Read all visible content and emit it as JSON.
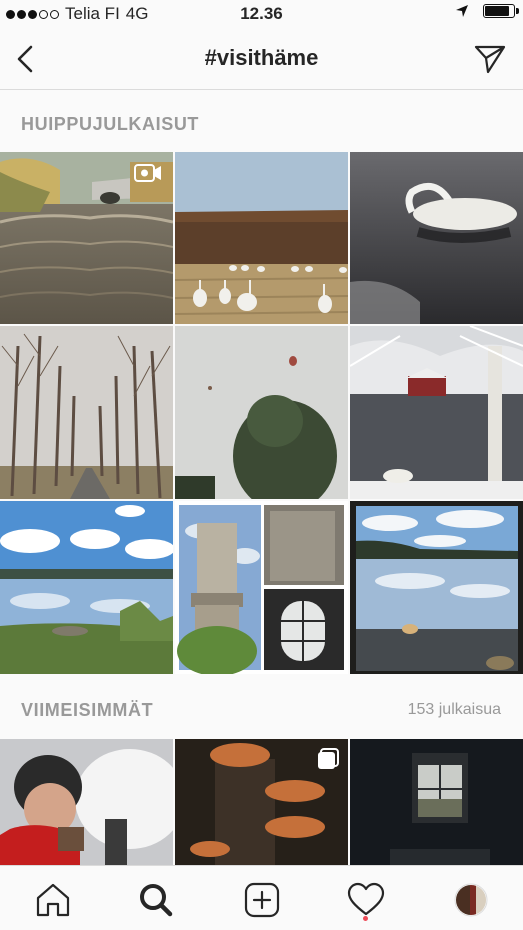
{
  "status_bar": {
    "carrier": "Telia FI",
    "network": "4G",
    "time": "12.36",
    "signal_filled": 3,
    "signal_total": 5,
    "battery_level": 0.9,
    "icons": [
      "location-arrow-icon",
      "battery-icon"
    ]
  },
  "header": {
    "title": "#visithäme",
    "back_icon": "chevron-left-icon",
    "share_icon": "send-icon"
  },
  "top_posts": {
    "label": "HUIPPUJULKAISUT",
    "posts": [
      {
        "subject": "river-rapids-bridge",
        "badge": "video-icon"
      },
      {
        "subject": "swans-in-field",
        "badge": ""
      },
      {
        "subject": "swan-on-lake",
        "badge": ""
      },
      {
        "subject": "birch-avenue",
        "badge": ""
      },
      {
        "subject": "hot-air-balloons-tree",
        "badge": ""
      },
      {
        "subject": "snowy-lake-red-cottage",
        "badge": ""
      },
      {
        "subject": "lake-clouds-shore",
        "badge": ""
      },
      {
        "subject": "stone-tower-collage",
        "badge": ""
      },
      {
        "subject": "lake-reflection-framed",
        "badge": ""
      }
    ]
  },
  "recent_posts": {
    "label": "VIIMEISIMMÄT",
    "count_text": "153 julkaisua",
    "posts": [
      {
        "subject": "woman-with-lantern",
        "badge": ""
      },
      {
        "subject": "mushrooms-on-stump",
        "badge": "multiple-posts-icon"
      },
      {
        "subject": "dark-room-window",
        "badge": ""
      }
    ]
  },
  "tab_bar": {
    "tabs": [
      {
        "name": "home-tab",
        "icon": "home-icon",
        "active": false
      },
      {
        "name": "search-tab",
        "icon": "search-icon",
        "active": true
      },
      {
        "name": "new-post-tab",
        "icon": "plus-square-icon",
        "active": false
      },
      {
        "name": "activity-tab",
        "icon": "heart-icon",
        "active": false
      },
      {
        "name": "profile-tab",
        "icon": "avatar",
        "active": false
      }
    ],
    "activity_notification": true
  },
  "colors": {
    "background": "#fafafa",
    "divider": "#dbdbdb",
    "text": "#262626",
    "secondary_text": "#999999",
    "notification": "#ed4956"
  }
}
